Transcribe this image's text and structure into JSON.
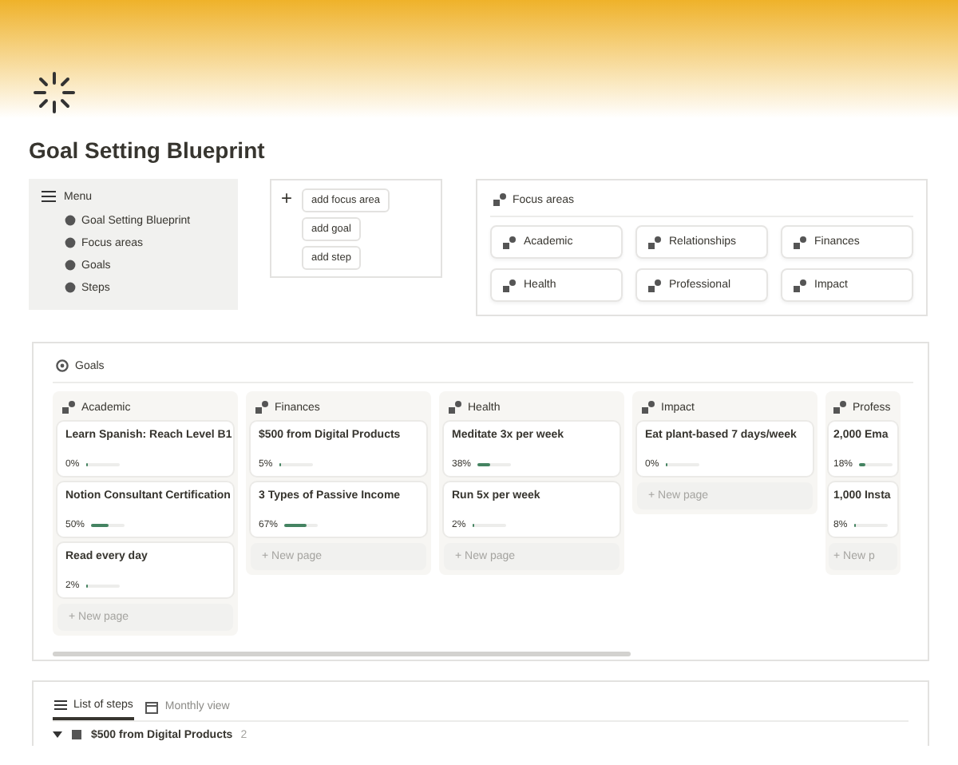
{
  "page": {
    "title": "Goal Setting Blueprint"
  },
  "menu": {
    "title": "Menu",
    "items": [
      {
        "label": "Goal Setting Blueprint"
      },
      {
        "label": "Focus areas"
      },
      {
        "label": "Goals"
      },
      {
        "label": "Steps"
      }
    ]
  },
  "quick_add": {
    "symbol": "+",
    "buttons": [
      "add focus area",
      "add goal",
      "add step"
    ]
  },
  "focus_areas": {
    "title": "Focus areas",
    "items": [
      "Academic",
      "Relationships",
      "Finances",
      "Health",
      "Professional",
      "Impact"
    ]
  },
  "goals": {
    "title": "Goals",
    "columns": [
      {
        "name": "Academic",
        "new_page": "+ New page",
        "cards": [
          {
            "title": "Learn Spanish: Reach Level B1",
            "percent": "0%",
            "level": 0
          },
          {
            "title": "Notion Consultant Certification",
            "percent": "50%",
            "level": 0.5
          },
          {
            "title": "Read every day",
            "percent": "2%",
            "level": 0.02
          }
        ]
      },
      {
        "name": "Finances",
        "new_page": "+ New page",
        "cards": [
          {
            "title": "$500 from Digital Products",
            "percent": "5%",
            "level": 0.05
          },
          {
            "title": "3 Types of Passive Income",
            "percent": "67%",
            "level": 0.67
          }
        ]
      },
      {
        "name": "Health",
        "new_page": "+ New page",
        "cards": [
          {
            "title": "Meditate 3x per week",
            "percent": "38%",
            "level": 0.38
          },
          {
            "title": "Run 5x per week",
            "percent": "2%",
            "level": 0.02
          }
        ]
      },
      {
        "name": "Impact",
        "new_page": "+ New page",
        "cards": [
          {
            "title": "Eat plant-based 7 days/week",
            "percent": "0%",
            "level": 0
          }
        ]
      },
      {
        "name": "Profess",
        "new_page": "+ New p",
        "cards": [
          {
            "title": "2,000 Ema",
            "percent": "18%",
            "level": 0.18
          },
          {
            "title": "1,000 Insta",
            "percent": "8%",
            "level": 0.08
          }
        ]
      }
    ]
  },
  "steps": {
    "tabs": [
      {
        "label": "List of steps",
        "selected": true
      },
      {
        "label": "Monthly view",
        "selected": false
      }
    ],
    "group": {
      "expanded": true,
      "title": "$500 from Digital Products",
      "count": "2"
    }
  }
}
